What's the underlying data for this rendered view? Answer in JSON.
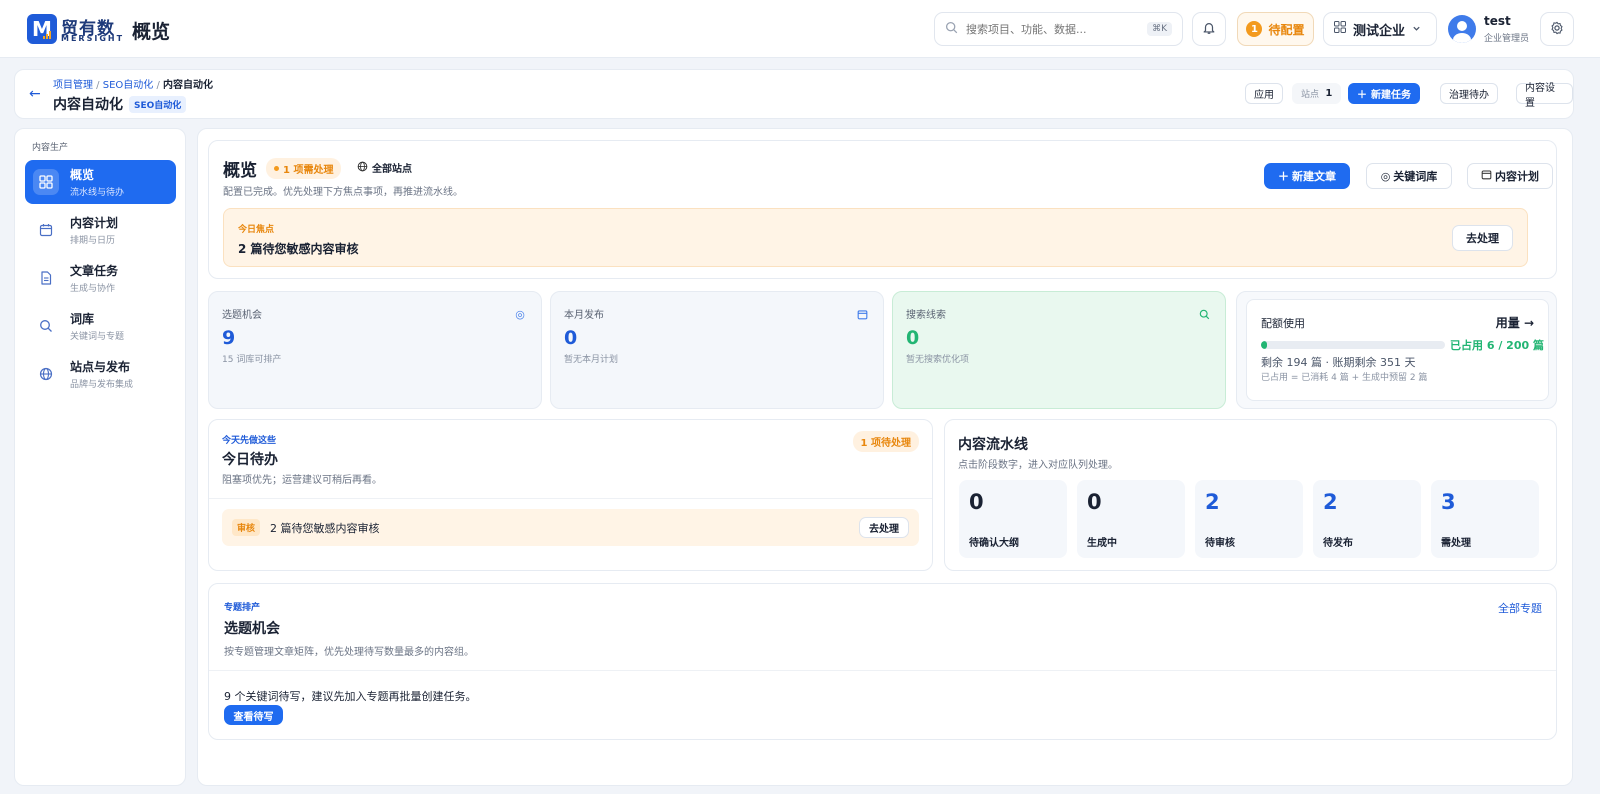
{
  "topbar": {
    "brand_cn": "贸有数",
    "brand_en": "MERSIGHT",
    "page_title": "概览",
    "search_placeholder": "搜索项目、功能、数据...",
    "search_shortcut": "⌘K",
    "pending_count": "1",
    "pending_label": "待配置",
    "company": "测试企业",
    "user_name": "test",
    "user_role": "企业管理员"
  },
  "header": {
    "breadcrumbs": [
      "项目管理",
      "SEO自动化",
      "内容自动化"
    ],
    "title": "内容自动化",
    "tag": "SEO自动化",
    "apply": "应用",
    "sites_label": "站点",
    "sites_count": "1",
    "new_task": "新建任务",
    "governance": "治理待办",
    "content_settings": "内容设置"
  },
  "sidebar": {
    "heading": "内容生产",
    "items": [
      {
        "title": "概览",
        "sub": "流水线与待办"
      },
      {
        "title": "内容计划",
        "sub": "排期与日历"
      },
      {
        "title": "文章任务",
        "sub": "生成与协作"
      },
      {
        "title": "词库",
        "sub": "关键词与专题"
      },
      {
        "title": "站点与发布",
        "sub": "品牌与发布集成"
      }
    ]
  },
  "overview": {
    "title": "概览",
    "pending_badge": "1 项需处理",
    "all_sites": "全部站点",
    "subtitle": "配置已完成。优先处理下方焦点事项，再推进流水线。",
    "new_article": "新建文章",
    "keyword_lib": "关键词库",
    "content_plan": "内容计划",
    "focus_kicker": "今日焦点",
    "focus_text": "2 篇待您敏感内容审核",
    "focus_action": "去处理"
  },
  "stats": [
    {
      "label": "选题机会",
      "value": "9",
      "sub": "15 词库可排产"
    },
    {
      "label": "本月发布",
      "value": "0",
      "sub": "暂无本月计划"
    },
    {
      "label": "搜索线索",
      "value": "0",
      "sub": "暂无搜索优化项"
    }
  ],
  "quota": {
    "title": "配额使用",
    "usage_link": "用量 →",
    "used_text": "已占用 6 / 200 篇",
    "used_fraction": 0.03,
    "remaining": "剩余 194 篇 · 账期剩余 351 天",
    "detail": "已占用 = 已消耗 4 篇 + 生成中预留 2 篇"
  },
  "todo": {
    "kicker": "今天先做这些",
    "badge": "1 项待处理",
    "title": "今日待办",
    "subtitle": "阻塞项优先；运营建议可稍后再看。",
    "item_tag": "审核",
    "item_text": "2 篇待您敏感内容审核",
    "item_action": "去处理"
  },
  "pipeline": {
    "title": "内容流水线",
    "subtitle": "点击阶段数字，进入对应队列处理。",
    "stages": [
      {
        "value": "0",
        "label": "待确认大纲"
      },
      {
        "value": "0",
        "label": "生成中"
      },
      {
        "value": "2",
        "label": "待审核"
      },
      {
        "value": "2",
        "label": "待发布"
      },
      {
        "value": "3",
        "label": "需处理"
      }
    ]
  },
  "topics": {
    "kicker": "专题排产",
    "title": "选题机会",
    "subtitle": "按专题管理文章矩阵，优先处理待写数量最多的内容组。",
    "all_link": "全部专题",
    "note": "9 个关键词待写，建议先加入专题再批量创建任务。",
    "view_button": "查看待写"
  },
  "colors": {
    "primary": "#1f6bf0",
    "accent_orange": "#e8870e",
    "green": "#22b573"
  }
}
